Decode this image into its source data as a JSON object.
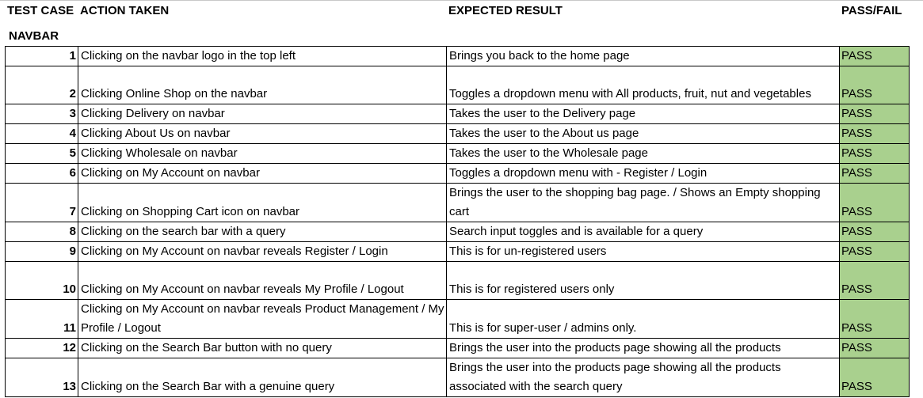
{
  "headers": {
    "test_case": "TEST CASE",
    "action_taken": "ACTION TAKEN",
    "expected_result": "EXPECTED RESULT",
    "pass_fail": "PASS/FAIL"
  },
  "section_title": "NAVBAR",
  "colors": {
    "pass_fill": "#a9d08e",
    "border": "#000000"
  },
  "rows": [
    {
      "num": "1",
      "action": "Clicking on the navbar logo in the top left",
      "expected": "Brings you back to the home page",
      "result": "PASS"
    },
    {
      "num": "2",
      "action": "Clicking Online Shop on the navbar",
      "expected": "Toggles a dropdown menu with All products, fruit, nut and vegetables",
      "result": "PASS"
    },
    {
      "num": "3",
      "action": "Clicking Delivery on navbar",
      "expected": "Takes the user to the Delivery page",
      "result": "PASS"
    },
    {
      "num": "4",
      "action": "Clicking About Us on navbar",
      "expected": "Takes the user to the About us page",
      "result": "PASS"
    },
    {
      "num": "5",
      "action": "Clicking Wholesale on navbar",
      "expected": "Takes the user to the Wholesale page",
      "result": "PASS"
    },
    {
      "num": "6",
      "action": "Clicking on My Account on navbar",
      "expected": "Toggles a dropdown menu with - Register / Login",
      "result": "PASS"
    },
    {
      "num": "7",
      "action": "Clicking on Shopping Cart icon on navbar",
      "expected": "Brings the user to the shopping bag page. / Shows an Empty shopping cart",
      "result": "PASS"
    },
    {
      "num": "8",
      "action": "Clicking on the search bar with a query",
      "expected": "Search input toggles and is available for a query",
      "result": "PASS"
    },
    {
      "num": "9",
      "action": "Clicking on My Account on navbar reveals Register / Login",
      "expected": "This is for un-registered users",
      "result": "PASS"
    },
    {
      "num": "10",
      "action": "Clicking on My Account on navbar reveals My Profile / Logout",
      "expected": "This is for registered users only",
      "result": "PASS"
    },
    {
      "num": "11",
      "action": "Clicking on My Account on navbar reveals Product Management / My Profile / Logout",
      "expected": "This is for super-user / admins only.",
      "result": "PASS"
    },
    {
      "num": "12",
      "action": "Clicking on the Search Bar button with no query",
      "expected": "Brings the user into the products page showing all the products",
      "result": "PASS"
    },
    {
      "num": "13",
      "action": "Clicking on the Search Bar with a genuine query",
      "expected": "Brings the user into the products page showing all the products associated with the search query",
      "result": "PASS"
    }
  ]
}
